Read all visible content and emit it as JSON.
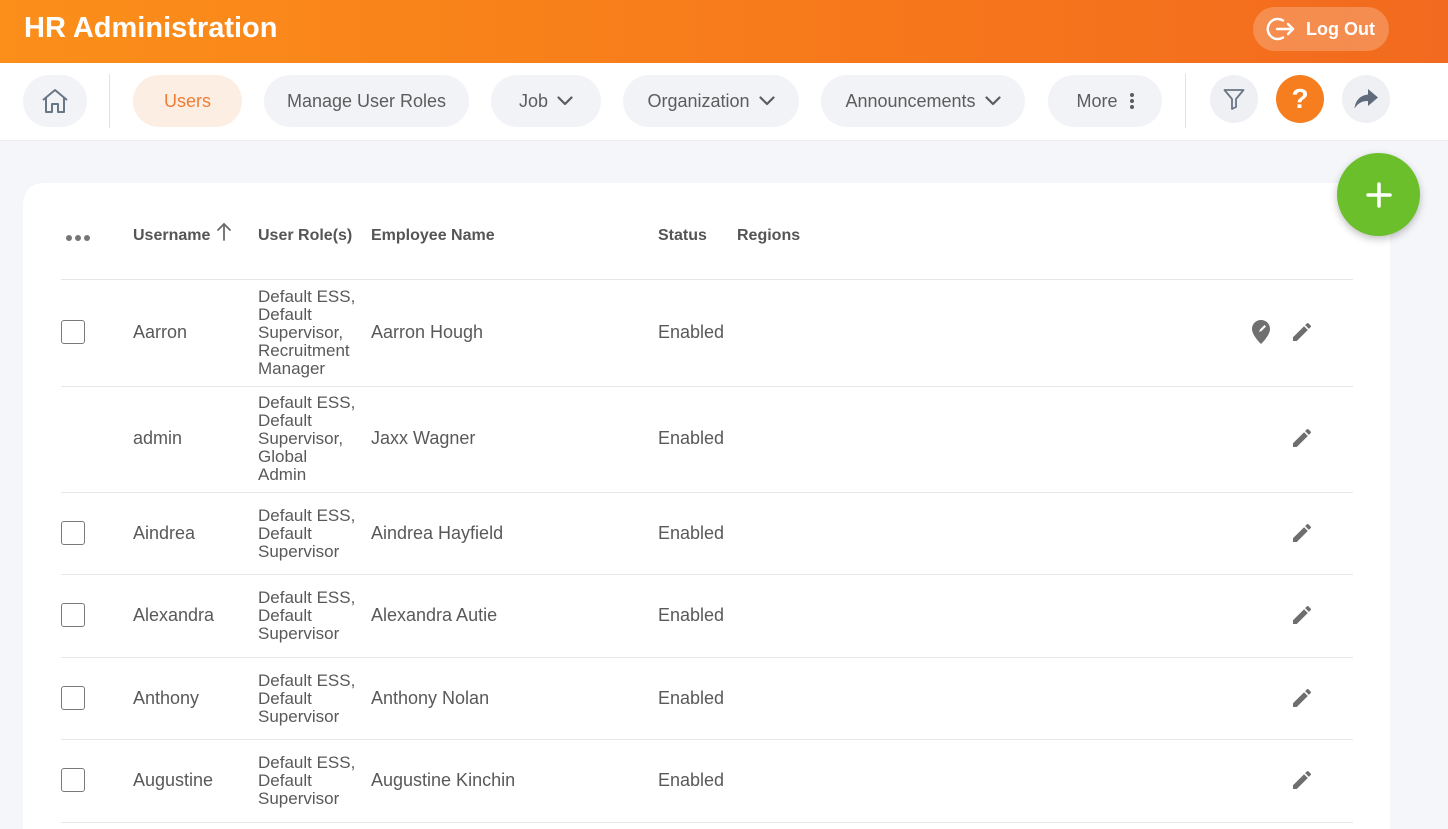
{
  "header": {
    "title": "HR Administration",
    "logout_label": "Log Out"
  },
  "nav": {
    "users": "Users",
    "manage_user_roles": "Manage User Roles",
    "job": "Job",
    "organization": "Organization",
    "announcements": "Announcements",
    "more": "More",
    "help": "?"
  },
  "table": {
    "columns": {
      "username": "Username",
      "user_roles": "User Role(s)",
      "employee_name": "Employee Name",
      "status": "Status",
      "regions": "Regions"
    },
    "rows": [
      {
        "username": "Aarron",
        "roles": [
          "Default ESS,",
          "Default",
          "Supervisor,",
          "Recruitment",
          "Manager"
        ],
        "employee": "Aarron Hough",
        "status": "Enabled",
        "checkbox": true,
        "region_pin": true
      },
      {
        "username": "admin",
        "roles": [
          "Default ESS,",
          "Default",
          "Supervisor,",
          "Global",
          "Admin"
        ],
        "employee": "Jaxx Wagner",
        "status": "Enabled",
        "checkbox": false,
        "region_pin": false
      },
      {
        "username": "Aindrea",
        "roles": [
          "Default ESS,",
          "Default",
          "Supervisor"
        ],
        "employee": "Aindrea Hayfield",
        "status": "Enabled",
        "checkbox": true,
        "region_pin": false
      },
      {
        "username": "Alexandra",
        "roles": [
          "Default ESS,",
          "Default",
          "Supervisor"
        ],
        "employee": "Alexandra Autie",
        "status": "Enabled",
        "checkbox": true,
        "region_pin": false
      },
      {
        "username": "Anthony",
        "roles": [
          "Default ESS,",
          "Default",
          "Supervisor"
        ],
        "employee": "Anthony Nolan",
        "status": "Enabled",
        "checkbox": true,
        "region_pin": false
      },
      {
        "username": "Augustine",
        "roles": [
          "Default ESS,",
          "Default",
          "Supervisor"
        ],
        "employee": "Augustine Kinchin",
        "status": "Enabled",
        "checkbox": true,
        "region_pin": false
      }
    ]
  },
  "colors": {
    "brand_orange": "#f7781b",
    "active_tab_text": "#f07c34",
    "add_button": "#6bbf2a",
    "help_button": "#f77e1f"
  }
}
